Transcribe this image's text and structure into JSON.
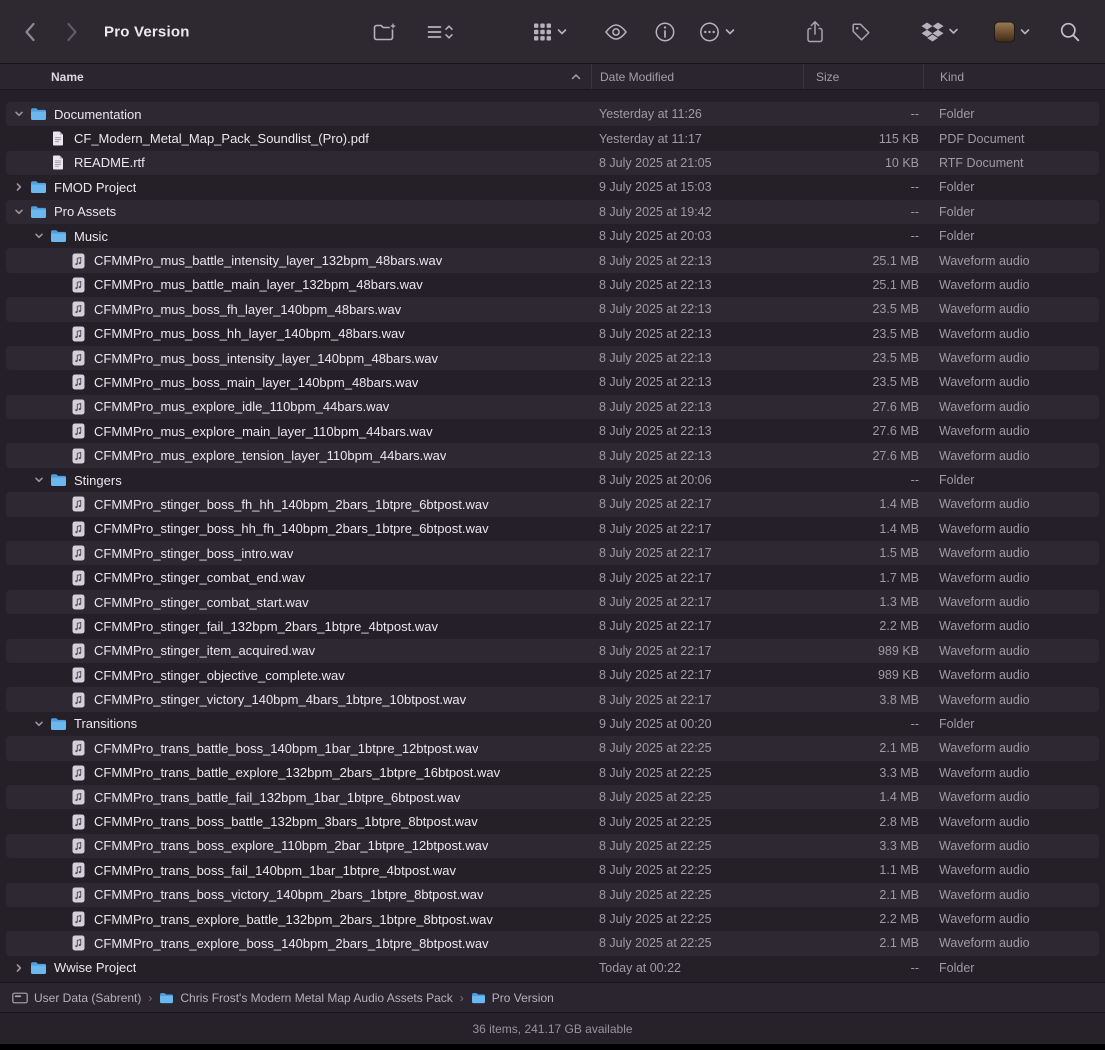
{
  "toolbar": {
    "title": "Pro Version",
    "icons": [
      "back-button",
      "forward-button",
      "new-folder-button",
      "list-view-sort-button",
      "group-view-button",
      "quick-look-button",
      "get-info-button",
      "more-actions-button",
      "share-button",
      "tag-button",
      "dropbox-button",
      "app-actions-button",
      "search-button"
    ]
  },
  "columns": {
    "name": "Name",
    "date": "Date Modified",
    "size": "Size",
    "kind": "Kind"
  },
  "rows": [
    {
      "name": "Documentation",
      "date": "Yesterday at 11:26",
      "size": "--",
      "kind": "Folder",
      "type": "folder",
      "indent": 0,
      "disclosure": "open"
    },
    {
      "name": "CF_Modern_Metal_Map_Pack_Soundlist_(Pro).pdf",
      "date": "Yesterday at 11:17",
      "size": "115 KB",
      "kind": "PDF Document",
      "type": "pdf",
      "indent": 1,
      "disclosure": "none"
    },
    {
      "name": "README.rtf",
      "date": "8 July 2025 at 21:05",
      "size": "10 KB",
      "kind": "RTF Document",
      "type": "rtf",
      "indent": 1,
      "disclosure": "none"
    },
    {
      "name": "FMOD Project",
      "date": "9 July 2025 at 15:03",
      "size": "--",
      "kind": "Folder",
      "type": "folder",
      "indent": 0,
      "disclosure": "closed"
    },
    {
      "name": "Pro Assets",
      "date": "8 July 2025 at 19:42",
      "size": "--",
      "kind": "Folder",
      "type": "folder",
      "indent": 0,
      "disclosure": "open"
    },
    {
      "name": "Music",
      "date": "8 July 2025 at 20:03",
      "size": "--",
      "kind": "Folder",
      "type": "folder",
      "indent": 1,
      "disclosure": "open"
    },
    {
      "name": "CFMMPro_mus_battle_intensity_layer_132bpm_48bars.wav",
      "date": "8 July 2025 at 22:13",
      "size": "25.1 MB",
      "kind": "Waveform audio",
      "type": "audio",
      "indent": 2,
      "disclosure": "none"
    },
    {
      "name": "CFMMPro_mus_battle_main_layer_132bpm_48bars.wav",
      "date": "8 July 2025 at 22:13",
      "size": "25.1 MB",
      "kind": "Waveform audio",
      "type": "audio",
      "indent": 2,
      "disclosure": "none"
    },
    {
      "name": "CFMMPro_mus_boss_fh_layer_140bpm_48bars.wav",
      "date": "8 July 2025 at 22:13",
      "size": "23.5 MB",
      "kind": "Waveform audio",
      "type": "audio",
      "indent": 2,
      "disclosure": "none"
    },
    {
      "name": "CFMMPro_mus_boss_hh_layer_140bpm_48bars.wav",
      "date": "8 July 2025 at 22:13",
      "size": "23.5 MB",
      "kind": "Waveform audio",
      "type": "audio",
      "indent": 2,
      "disclosure": "none"
    },
    {
      "name": "CFMMPro_mus_boss_intensity_layer_140bpm_48bars.wav",
      "date": "8 July 2025 at 22:13",
      "size": "23.5 MB",
      "kind": "Waveform audio",
      "type": "audio",
      "indent": 2,
      "disclosure": "none"
    },
    {
      "name": "CFMMPro_mus_boss_main_layer_140bpm_48bars.wav",
      "date": "8 July 2025 at 22:13",
      "size": "23.5 MB",
      "kind": "Waveform audio",
      "type": "audio",
      "indent": 2,
      "disclosure": "none"
    },
    {
      "name": "CFMMPro_mus_explore_idle_110bpm_44bars.wav",
      "date": "8 July 2025 at 22:13",
      "size": "27.6 MB",
      "kind": "Waveform audio",
      "type": "audio",
      "indent": 2,
      "disclosure": "none"
    },
    {
      "name": "CFMMPro_mus_explore_main_layer_110bpm_44bars.wav",
      "date": "8 July 2025 at 22:13",
      "size": "27.6 MB",
      "kind": "Waveform audio",
      "type": "audio",
      "indent": 2,
      "disclosure": "none"
    },
    {
      "name": "CFMMPro_mus_explore_tension_layer_110bpm_44bars.wav",
      "date": "8 July 2025 at 22:13",
      "size": "27.6 MB",
      "kind": "Waveform audio",
      "type": "audio",
      "indent": 2,
      "disclosure": "none"
    },
    {
      "name": "Stingers",
      "date": "8 July 2025 at 20:06",
      "size": "--",
      "kind": "Folder",
      "type": "folder",
      "indent": 1,
      "disclosure": "open"
    },
    {
      "name": "CFMMPro_stinger_boss_fh_hh_140bpm_2bars_1btpre_6btpost.wav",
      "date": "8 July 2025 at 22:17",
      "size": "1.4 MB",
      "kind": "Waveform audio",
      "type": "audio",
      "indent": 2,
      "disclosure": "none"
    },
    {
      "name": "CFMMPro_stinger_boss_hh_fh_140bpm_2bars_1btpre_6btpost.wav",
      "date": "8 July 2025 at 22:17",
      "size": "1.4 MB",
      "kind": "Waveform audio",
      "type": "audio",
      "indent": 2,
      "disclosure": "none"
    },
    {
      "name": "CFMMPro_stinger_boss_intro.wav",
      "date": "8 July 2025 at 22:17",
      "size": "1.5 MB",
      "kind": "Waveform audio",
      "type": "audio",
      "indent": 2,
      "disclosure": "none"
    },
    {
      "name": "CFMMPro_stinger_combat_end.wav",
      "date": "8 July 2025 at 22:17",
      "size": "1.7 MB",
      "kind": "Waveform audio",
      "type": "audio",
      "indent": 2,
      "disclosure": "none"
    },
    {
      "name": "CFMMPro_stinger_combat_start.wav",
      "date": "8 July 2025 at 22:17",
      "size": "1.3 MB",
      "kind": "Waveform audio",
      "type": "audio",
      "indent": 2,
      "disclosure": "none"
    },
    {
      "name": "CFMMPro_stinger_fail_132bpm_2bars_1btpre_4btpost.wav",
      "date": "8 July 2025 at 22:17",
      "size": "2.2 MB",
      "kind": "Waveform audio",
      "type": "audio",
      "indent": 2,
      "disclosure": "none"
    },
    {
      "name": "CFMMPro_stinger_item_acquired.wav",
      "date": "8 July 2025 at 22:17",
      "size": "989 KB",
      "kind": "Waveform audio",
      "type": "audio",
      "indent": 2,
      "disclosure": "none"
    },
    {
      "name": "CFMMPro_stinger_objective_complete.wav",
      "date": "8 July 2025 at 22:17",
      "size": "989 KB",
      "kind": "Waveform audio",
      "type": "audio",
      "indent": 2,
      "disclosure": "none"
    },
    {
      "name": "CFMMPro_stinger_victory_140bpm_4bars_1btpre_10btpost.wav",
      "date": "8 July 2025 at 22:17",
      "size": "3.8 MB",
      "kind": "Waveform audio",
      "type": "audio",
      "indent": 2,
      "disclosure": "none"
    },
    {
      "name": "Transitions",
      "date": "9 July 2025 at 00:20",
      "size": "--",
      "kind": "Folder",
      "type": "folder",
      "indent": 1,
      "disclosure": "open"
    },
    {
      "name": "CFMMPro_trans_battle_boss_140bpm_1bar_1btpre_12btpost.wav",
      "date": "8 July 2025 at 22:25",
      "size": "2.1 MB",
      "kind": "Waveform audio",
      "type": "audio",
      "indent": 2,
      "disclosure": "none"
    },
    {
      "name": "CFMMPro_trans_battle_explore_132bpm_2bars_1btpre_16btpost.wav",
      "date": "8 July 2025 at 22:25",
      "size": "3.3 MB",
      "kind": "Waveform audio",
      "type": "audio",
      "indent": 2,
      "disclosure": "none"
    },
    {
      "name": "CFMMPro_trans_battle_fail_132bpm_1bar_1btpre_6btpost.wav",
      "date": "8 July 2025 at 22:25",
      "size": "1.4 MB",
      "kind": "Waveform audio",
      "type": "audio",
      "indent": 2,
      "disclosure": "none"
    },
    {
      "name": "CFMMPro_trans_boss_battle_132bpm_3bars_1btpre_8btpost.wav",
      "date": "8 July 2025 at 22:25",
      "size": "2.8 MB",
      "kind": "Waveform audio",
      "type": "audio",
      "indent": 2,
      "disclosure": "none"
    },
    {
      "name": "CFMMPro_trans_boss_explore_110bpm_2bar_1btpre_12btpost.wav",
      "date": "8 July 2025 at 22:25",
      "size": "3.3 MB",
      "kind": "Waveform audio",
      "type": "audio",
      "indent": 2,
      "disclosure": "none"
    },
    {
      "name": "CFMMPro_trans_boss_fail_140bpm_1bar_1btpre_4btpost.wav",
      "date": "8 July 2025 at 22:25",
      "size": "1.1 MB",
      "kind": "Waveform audio",
      "type": "audio",
      "indent": 2,
      "disclosure": "none"
    },
    {
      "name": "CFMMPro_trans_boss_victory_140bpm_2bars_1btpre_8btpost.wav",
      "date": "8 July 2025 at 22:25",
      "size": "2.1 MB",
      "kind": "Waveform audio",
      "type": "audio",
      "indent": 2,
      "disclosure": "none"
    },
    {
      "name": "CFMMPro_trans_explore_battle_132bpm_2bars_1btpre_8btpost.wav",
      "date": "8 July 2025 at 22:25",
      "size": "2.2 MB",
      "kind": "Waveform audio",
      "type": "audio",
      "indent": 2,
      "disclosure": "none"
    },
    {
      "name": "CFMMPro_trans_explore_boss_140bpm_2bars_1btpre_8btpost.wav",
      "date": "8 July 2025 at 22:25",
      "size": "2.1 MB",
      "kind": "Waveform audio",
      "type": "audio",
      "indent": 2,
      "disclosure": "none"
    },
    {
      "name": "Wwise Project",
      "date": "Today at 00:22",
      "size": "--",
      "kind": "Folder",
      "type": "folder",
      "indent": 0,
      "disclosure": "closed"
    }
  ],
  "pathbar": {
    "separator": "›",
    "items": [
      {
        "label": "User Data (Sabrent)",
        "icon": "disk"
      },
      {
        "label": "Chris Frost's Modern Metal Map Audio Assets Pack",
        "icon": "folder"
      },
      {
        "label": "Pro Version",
        "icon": "folder"
      }
    ]
  },
  "statusbar": {
    "text": "36 items, 241.17 GB available"
  }
}
